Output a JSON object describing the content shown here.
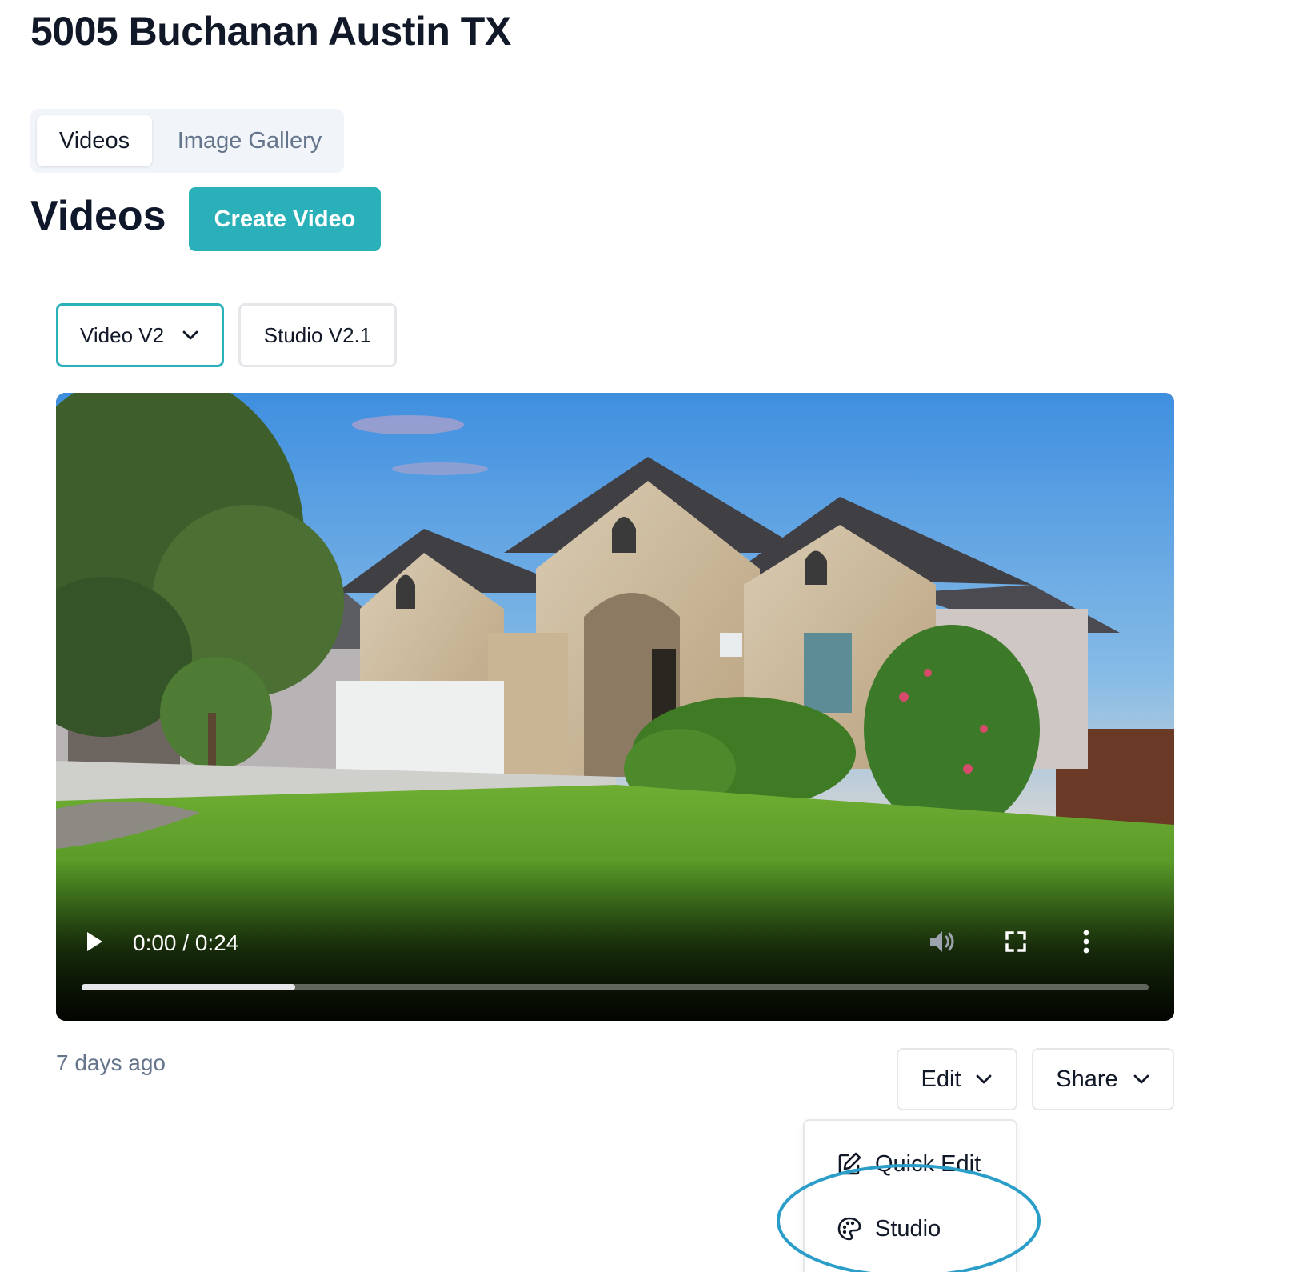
{
  "page": {
    "title": "5005 Buchanan Austin TX"
  },
  "tabs": [
    {
      "label": "Videos",
      "active": true
    },
    {
      "label": "Image Gallery",
      "active": false
    }
  ],
  "section": {
    "heading": "Videos",
    "create_button_label": "Create Video"
  },
  "version_selector": {
    "selected": "Video V2",
    "alt_option": "Studio V2.1"
  },
  "video": {
    "time_display": "0:00 / 0:24",
    "buffered_fraction": 0.2,
    "icons": [
      "play-icon",
      "volume-icon",
      "fullscreen-icon",
      "more-options-icon"
    ]
  },
  "meta": {
    "timestamp": "7 days ago"
  },
  "actions": {
    "edit_label": "Edit",
    "share_label": "Share"
  },
  "edit_menu": {
    "items": [
      {
        "label": "Quick Edit",
        "icon": "pencil-square-icon"
      },
      {
        "label": "Studio",
        "icon": "palette-icon"
      }
    ],
    "highlighted": "Studio"
  },
  "colors": {
    "accent": "#2ab0b9",
    "highlight_ring": "#2a9ec9",
    "muted_text": "#64748b",
    "border": "#e5e7eb"
  }
}
